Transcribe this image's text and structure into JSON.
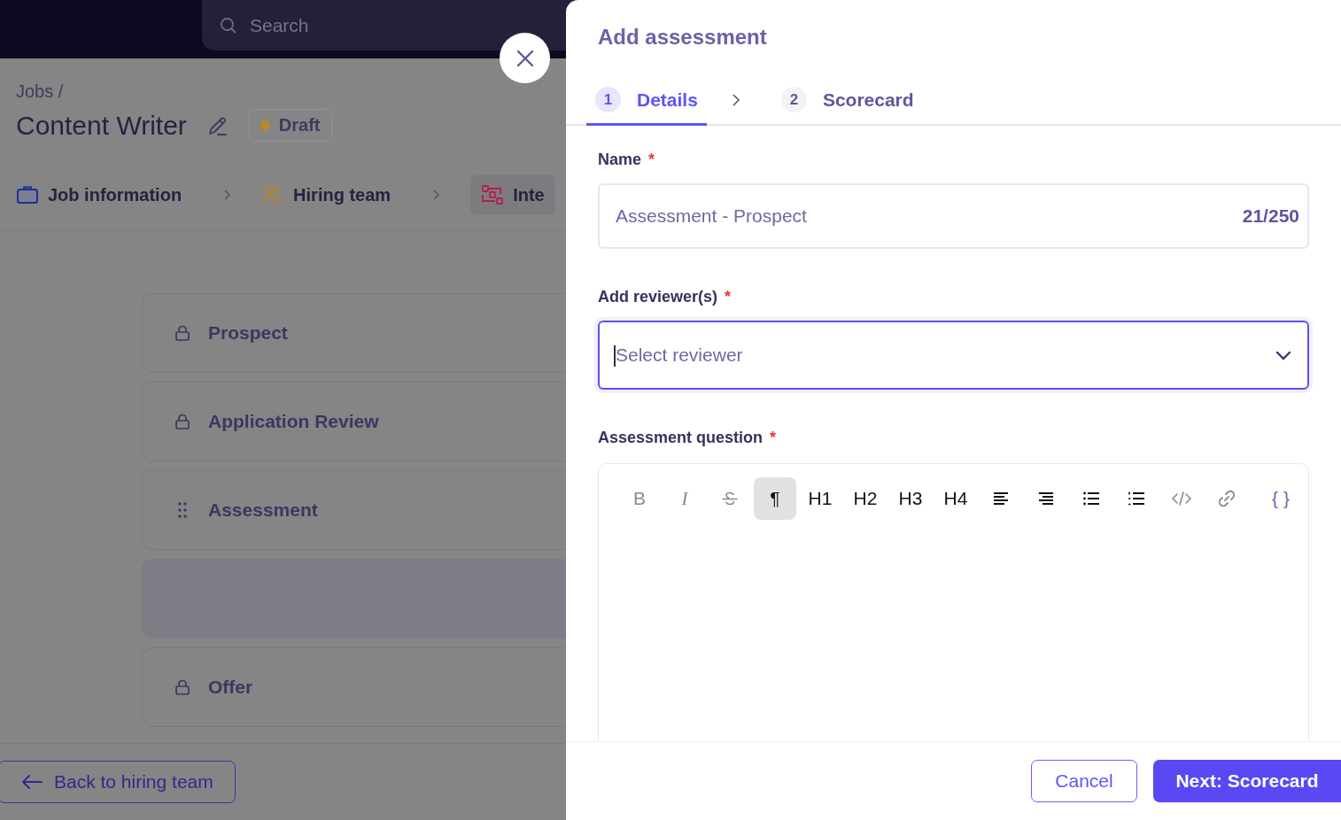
{
  "topbar": {
    "search": {
      "placeholder": "Search"
    }
  },
  "page": {
    "breadcrumb": "Jobs /",
    "title": "Content Writer",
    "status": {
      "label": "Draft",
      "color": "#b8892a"
    },
    "steps": [
      {
        "label": "Job information",
        "kind": "briefcase",
        "selected": false
      },
      {
        "label": "Hiring team",
        "kind": "people",
        "selected": false
      },
      {
        "label": "Inte",
        "kind": "workflow",
        "selected": true
      }
    ],
    "stages": [
      {
        "label": "Prospect",
        "kind": "locked"
      },
      {
        "label": "Application Review",
        "kind": "locked"
      },
      {
        "label": "Assessment",
        "kind": "draggable"
      },
      {
        "kind": "dropzone"
      },
      {
        "label": "Offer",
        "kind": "locked"
      }
    ],
    "back_button": "Back to hiring team"
  },
  "drawer": {
    "title": "Add assessment",
    "tabs": [
      {
        "number": "1",
        "label": "Details",
        "selected": true
      },
      {
        "number": "2",
        "label": "Scorecard",
        "selected": false
      }
    ],
    "name": {
      "label": "Name",
      "required_mark": "*",
      "value": "Assessment - Prospect",
      "counter": "21/250"
    },
    "reviewers": {
      "label": "Add reviewer(s)",
      "required_mark": "*",
      "placeholder": "Select reviewer",
      "focused": true
    },
    "question": {
      "label": "Assessment question",
      "required_mark": "*",
      "toolbar": [
        {
          "kind": "text",
          "label": "B",
          "selected": false,
          "disabled": true
        },
        {
          "kind": "italic",
          "label": "I",
          "selected": false,
          "disabled": true
        },
        {
          "kind": "strike",
          "selected": false,
          "disabled": true
        },
        {
          "kind": "text",
          "label": "¶",
          "selected": true,
          "disabled": false
        },
        {
          "kind": "text",
          "label": "H1",
          "selected": false,
          "disabled": false
        },
        {
          "kind": "text",
          "label": "H2",
          "selected": false,
          "disabled": false
        },
        {
          "kind": "text",
          "label": "H3",
          "selected": false,
          "disabled": false
        },
        {
          "kind": "text",
          "label": "H4",
          "selected": false,
          "disabled": false
        },
        {
          "kind": "align-left",
          "selected": false,
          "disabled": false
        },
        {
          "kind": "align-right",
          "selected": false,
          "disabled": false
        },
        {
          "kind": "bullet-list",
          "selected": false,
          "disabled": false
        },
        {
          "kind": "numbered-list",
          "selected": false,
          "disabled": false
        },
        {
          "kind": "code",
          "selected": false,
          "disabled": true
        },
        {
          "kind": "link",
          "selected": false,
          "disabled": true
        },
        {
          "kind": "variable",
          "label": "{ }",
          "selected": false,
          "disabled": false
        }
      ]
    },
    "buttons": {
      "cancel": "Cancel",
      "next": "Next: Scorecard"
    }
  }
}
